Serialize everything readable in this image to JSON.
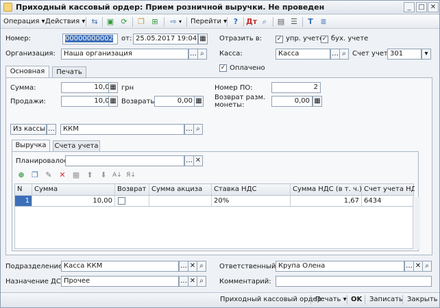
{
  "window": {
    "title": "Приходный кассовый ордер: Прием розничной выручки. Не проведен",
    "controls": [
      "_",
      "□",
      "✕"
    ]
  },
  "toolbar": {
    "operation": "Операция ▾",
    "actions": "Действия ▾",
    "goto": "Перейти ▾",
    "help": "?"
  },
  "header": {
    "number_label": "Номер:",
    "number_value": "00000000002",
    "from_label": "от:",
    "date_value": "25.05.2017 19:04:45",
    "org_label": "Организация:",
    "org_value": "Наша организация",
    "reflect_label": "Отразить в:",
    "mgmt_label": "упр. учете",
    "acc_label": "бух. учете",
    "mgmt_checked": true,
    "acc_checked": true,
    "cashbox_label": "Касса:",
    "cashbox_value": "Касса",
    "account_label": "Счет учета:",
    "account_value": "301",
    "paid_label": "Оплачено",
    "paid_checked": true
  },
  "tabs": [
    "Основная",
    "Печать"
  ],
  "main": {
    "sum_label": "Сумма:",
    "sum_value": "10,00",
    "currency": "грн",
    "sales_label": "Продажи:",
    "sales_value": "10,00",
    "returns_label": "Возвраты:",
    "returns_value": "0,00",
    "po_label": "Номер ПО:",
    "po_value": "2",
    "coins_label_1": "Возврат разм.",
    "coins_label_2": "монеты:",
    "coins_value": "0,00",
    "from_cash_label": "Из кассы",
    "kkm_value": "ККМ"
  },
  "inner_tabs": [
    "Выручка",
    "Счета учета"
  ],
  "planned_label": "Планировалось:",
  "grid": {
    "columns": [
      "N",
      "Сумма",
      "Возврат",
      "Сумма акциза",
      "Ставка НДС",
      "Сумма НДС (в т. ч.)",
      "Счет учета НДС"
    ],
    "rows": [
      {
        "n": "1",
        "sum": "10,00",
        "return": false,
        "excise": "",
        "vat_rate": "20%",
        "vat_sum": "1,67",
        "vat_account": "6434"
      }
    ]
  },
  "footer": {
    "department_label": "Подразделение:",
    "department_value": "Касса ККМ",
    "purpose_label": "Назначение ДС:",
    "purpose_value": "Прочее",
    "responsible_label": "Ответственный:",
    "responsible_value": "Крупа Олена",
    "comment_label": "Комментарий:",
    "comment_value": ""
  },
  "bottombar": {
    "doc_name": "Приходный кассовый ордер",
    "print": "Печать ▾",
    "ok": "OK",
    "save": "Записать",
    "close": "Закрыть"
  },
  "colors": {
    "accent": "#3d6fb8",
    "window_bg": "#eef1f5",
    "delete_red": "#d03030",
    "add_green": "#2f9a3a"
  }
}
